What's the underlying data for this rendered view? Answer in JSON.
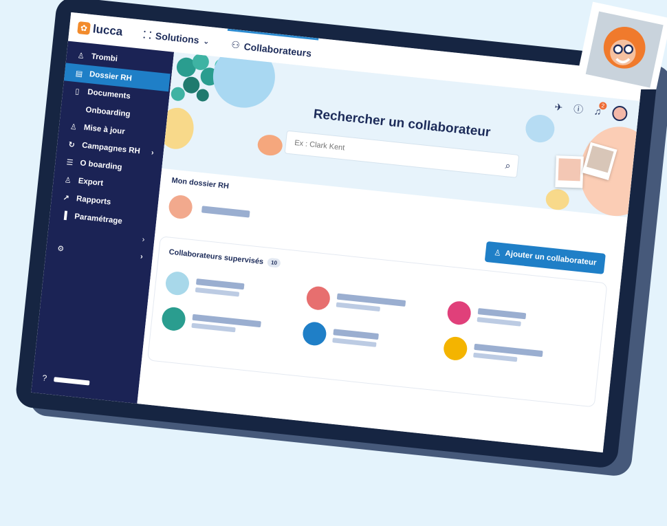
{
  "app": {
    "logo_text": "lucca",
    "solutions_label": "Solutions",
    "active_tab_label": "Collaborateurs"
  },
  "sidebar": {
    "items": [
      {
        "label": "Trombi",
        "icon": "person-icon",
        "glyph": "♕"
      },
      {
        "label": "Dossier RH",
        "icon": "id-card-icon",
        "glyph": "▤",
        "active": true
      },
      {
        "label": "Documents",
        "icon": "document-icon",
        "glyph": "▯"
      },
      {
        "label": "Onboarding",
        "icon": "",
        "glyph": ""
      },
      {
        "label": "Mise à jour",
        "icon": "person-add-icon",
        "glyph": "♙"
      },
      {
        "label": "Campagnes RH",
        "icon": "refresh-icon",
        "glyph": "↻",
        "chevron": true
      },
      {
        "label": "O boarding",
        "icon": "list-icon",
        "glyph": "☰"
      },
      {
        "label": "Export",
        "icon": "person-export-icon",
        "glyph": "♙"
      },
      {
        "label": "Rapports",
        "icon": "external-link-icon",
        "glyph": "↗"
      },
      {
        "label": "Paramétrage",
        "icon": "chart-icon",
        "glyph": "▐"
      }
    ],
    "help_icon": "help-icon"
  },
  "hero": {
    "title": "Rechercher un collaborateur",
    "search_placeholder": "Ex : Clark Kent",
    "notification_count": "2"
  },
  "my_file": {
    "label": "Mon dossier RH"
  },
  "add_button": {
    "label": "Ajouter un collaborateur"
  },
  "supervised": {
    "title": "Collaborateurs supervisés",
    "count": "10"
  },
  "colors": {
    "sidebar_bg": "#1b2355",
    "accent": "#1f7fc7",
    "hero_bg": "#e7f3fb",
    "tablet_frame": "#162542",
    "notification_badge": "#ef6c34"
  }
}
